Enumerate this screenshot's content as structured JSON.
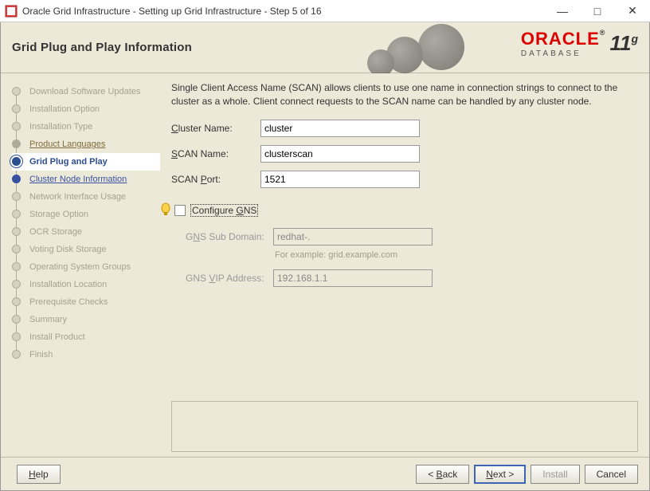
{
  "titlebar": {
    "title": "Oracle Grid Infrastructure - Setting up Grid Infrastructure - Step 5 of 16"
  },
  "header": {
    "page_title": "Grid Plug and Play Information",
    "brand": "ORACLE",
    "brand_sub": "DATABASE",
    "version": "11",
    "version_sup": "g"
  },
  "steps": [
    {
      "label": "Download Software Updates",
      "state": "done"
    },
    {
      "label": "Installation Option",
      "state": "done"
    },
    {
      "label": "Installation Type",
      "state": "done"
    },
    {
      "label": "Product Languages",
      "state": "visited"
    },
    {
      "label": "Grid Plug and Play",
      "state": "current"
    },
    {
      "label": "Cluster Node Information",
      "state": "link"
    },
    {
      "label": "Network Interface Usage",
      "state": "future"
    },
    {
      "label": "Storage Option",
      "state": "future"
    },
    {
      "label": "OCR Storage",
      "state": "future"
    },
    {
      "label": "Voting Disk Storage",
      "state": "future"
    },
    {
      "label": "Operating System Groups",
      "state": "future"
    },
    {
      "label": "Installation Location",
      "state": "future"
    },
    {
      "label": "Prerequisite Checks",
      "state": "future"
    },
    {
      "label": "Summary",
      "state": "future"
    },
    {
      "label": "Install Product",
      "state": "future"
    },
    {
      "label": "Finish",
      "state": "future"
    }
  ],
  "content": {
    "description": "Single Client Access Name (SCAN) allows clients to use one name in connection strings to connect to the cluster as a whole. Client connect requests to the SCAN name can be handled by any cluster node.",
    "cluster_name_label": "Cluster Name:",
    "cluster_name_value": "cluster",
    "scan_name_label": "SCAN Name:",
    "scan_name_value": "clusterscan",
    "scan_port_label": "SCAN Port:",
    "scan_port_value": "1521",
    "configure_gns_label": "Configure GNS",
    "gns_sub_domain_label": "GNS Sub Domain:",
    "gns_sub_domain_value": "redhat-.",
    "gns_example": "For example: grid.example.com",
    "gns_vip_label": "GNS VIP Address:",
    "gns_vip_value": "192.168.1.1"
  },
  "buttons": {
    "help": "Help",
    "back": "< Back",
    "next": "Next >",
    "install": "Install",
    "cancel": "Cancel"
  }
}
